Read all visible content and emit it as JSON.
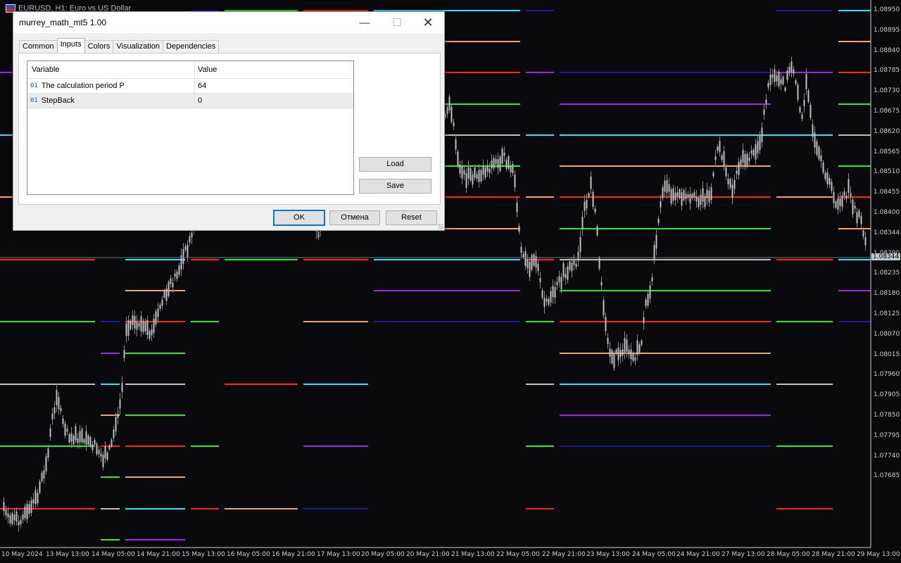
{
  "chart": {
    "title": "EURUSD, H1:  Euro vs US Dollar",
    "price_labels": [
      "1.08950",
      "1.08895",
      "1.08840",
      "1.08785",
      "1.08730",
      "1.08675",
      "1.08620",
      "1.08565",
      "1.08510",
      "1.08455",
      "1.08400",
      "1.08344",
      "1.08290",
      "1.08235",
      "1.08180",
      "1.08125",
      "1.08070",
      "1.08015",
      "1.07960",
      "1.07905",
      "1.07850",
      "1.07795",
      "1.07740",
      "1.07685"
    ],
    "current_price": "1.08344",
    "time_labels": [
      "10 May 2024",
      "13 May 13:00",
      "14 May 05:00",
      "14 May 21:00",
      "15 May 13:00",
      "16 May 05:00",
      "16 May 21:00",
      "17 May 13:00",
      "20 May 05:00",
      "20 May 21:00",
      "21 May 13:00",
      "22 May 05:00",
      "22 May 21:00",
      "23 May 13:00",
      "24 May 05:00",
      "24 May 21:00",
      "27 May 13:00",
      "28 May 05:00",
      "28 May 21:00",
      "29 May 13:00"
    ],
    "colors": {
      "background": "#0a0a0e",
      "candle": "#c0c0c0",
      "red": "#ff2020",
      "green": "#22ee22",
      "cyan": "#22e6ff",
      "orange": "#f4a460",
      "purple": "#a020f0",
      "navy": "#1a1a9a",
      "gray": "#c0c0c0"
    }
  },
  "dialog": {
    "title": "murrey_math_mt5 1.00",
    "tabs": [
      "Common",
      "Inputs",
      "Colors",
      "Visualization",
      "Dependencies"
    ],
    "active_tab": "Inputs",
    "grid": {
      "headers": {
        "variable": "Variable",
        "value": "Value"
      },
      "rows": [
        {
          "type": "01",
          "variable": "The calculation period P",
          "value": "64"
        },
        {
          "type": "01",
          "variable": "StepBack",
          "value": "0"
        }
      ]
    },
    "buttons": {
      "load": "Load",
      "save": "Save",
      "ok": "OK",
      "cancel": "Отмена",
      "reset": "Reset"
    }
  }
}
